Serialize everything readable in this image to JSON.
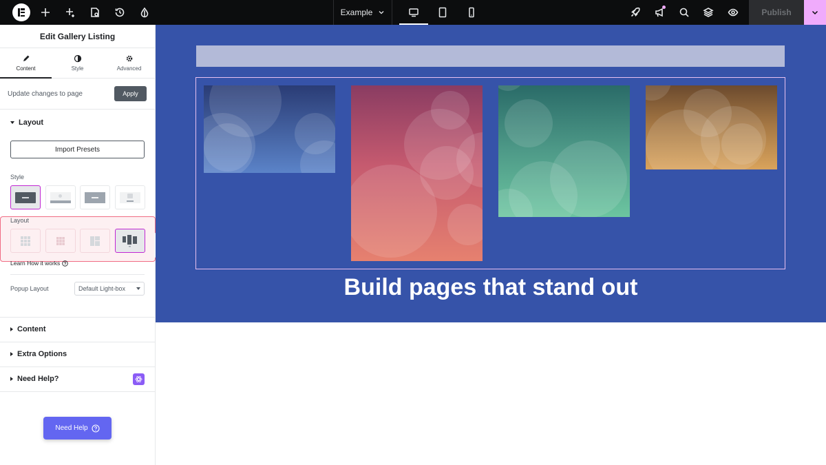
{
  "topbar": {
    "document_name": "Example",
    "publish_label": "Publish",
    "icons": [
      "elementor-logo-icon",
      "plus-icon",
      "sparkle-icon",
      "page-settings-icon",
      "history-icon",
      "theme-style-icon",
      "desktop-icon",
      "tablet-icon",
      "mobile-icon",
      "rocket-icon",
      "announcement-icon",
      "search-icon",
      "layers-icon",
      "preview-eye-icon",
      "chevron-down-icon"
    ]
  },
  "panel": {
    "title": "Edit Gallery Listing",
    "tabs": [
      {
        "label": "Content",
        "icon": "pencil-icon",
        "active": true
      },
      {
        "label": "Style",
        "icon": "half-circle-icon",
        "active": false
      },
      {
        "label": "Advanced",
        "icon": "gear-icon",
        "active": false
      }
    ],
    "update_text": "Update changes to page",
    "apply_label": "Apply",
    "layout_section": {
      "title": "Layout",
      "import_label": "Import Presets",
      "style_label": "Style",
      "layout_label": "Layout",
      "learn_label": "Learn How it works",
      "popup_label": "Popup Layout",
      "popup_value": "Default Light-box"
    },
    "sections": [
      {
        "title": "Content"
      },
      {
        "title": "Extra Options"
      },
      {
        "title": "Need Help?"
      }
    ],
    "need_help_button": "Need Help"
  },
  "canvas": {
    "heading": "Build pages that stand out",
    "colors": {
      "hero_bg": "#3653a9",
      "accent": "#f0abfc",
      "highlight": "#f06c84"
    }
  }
}
